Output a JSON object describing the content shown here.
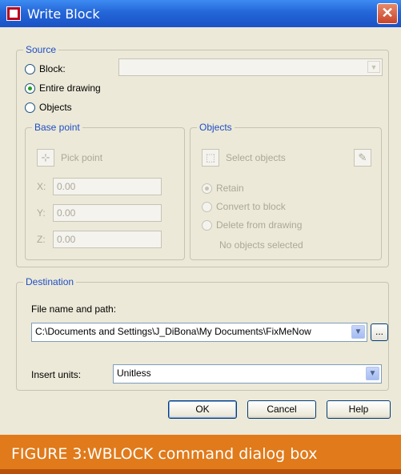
{
  "window": {
    "title": "Write Block",
    "icons": {
      "app": "autocad-app-icon",
      "close": "close-icon"
    },
    "colors": {
      "titlebar": "#2466d8",
      "group_legend": "#1f4ec4",
      "banner": "#e07a1a"
    }
  },
  "source": {
    "legend": "Source",
    "options": [
      {
        "label": "Block:",
        "checked": false
      },
      {
        "label": "Entire drawing",
        "checked": true
      },
      {
        "label": "Objects",
        "checked": false
      }
    ],
    "block_combo_value": ""
  },
  "base_point": {
    "legend": "Base point",
    "pick_point_label": "Pick point",
    "x_label": "X:",
    "x_value": "0.00",
    "y_label": "Y:",
    "y_value": "0.00",
    "z_label": "Z:",
    "z_value": "0.00"
  },
  "objects": {
    "legend": "Objects",
    "select_objects_label": "Select objects",
    "options": [
      {
        "label": "Retain",
        "checked": true
      },
      {
        "label": "Convert to block",
        "checked": false
      },
      {
        "label": "Delete from drawing",
        "checked": false
      }
    ],
    "status": "No objects selected"
  },
  "destination": {
    "legend": "Destination",
    "file_label": "File name and path:",
    "file_value": "C:\\Documents and Settings\\J_DiBona\\My Documents\\FixMeNow",
    "browse_label": "...",
    "units_label": "Insert units:",
    "units_value": "Unitless"
  },
  "buttons": {
    "ok": "OK",
    "cancel": "Cancel",
    "help": "Help"
  },
  "caption": "FIGURE 3:WBLOCK command dialog box"
}
